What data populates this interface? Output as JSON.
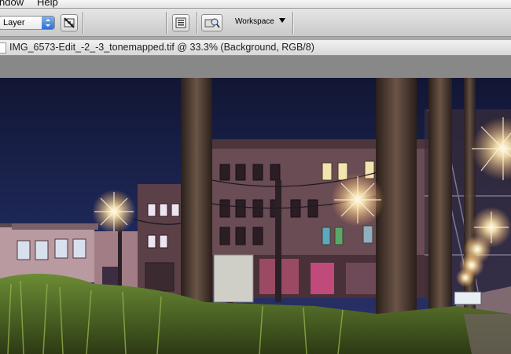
{
  "menubar": {
    "items": [
      "ndow",
      "Help"
    ]
  },
  "options": {
    "layer_select": "Layer",
    "workspace_label": "Workspace",
    "icons": [
      "transparency-icon",
      "palette-icon",
      "file-browser-icon"
    ]
  },
  "document": {
    "title": "IMG_6573-Edit_-2_-3_tonemapped.tif @ 33.3% (Background, RGB/8)"
  },
  "colors": {
    "accent": "#2f6fd1",
    "sky": "#141a3c",
    "grass": "#5a7a2a"
  }
}
